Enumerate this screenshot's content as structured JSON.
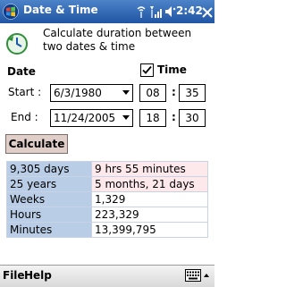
{
  "titlebar": {
    "title": "Date & Time",
    "clock": "2:42",
    "ok_label": ""
  },
  "header": {
    "description": "Calculate duration between two dates & time"
  },
  "date_section": {
    "label": "Date"
  },
  "time_section": {
    "label": "Time",
    "checked": true
  },
  "start": {
    "label": "Start :",
    "date": "6/3/1980",
    "hour": "08",
    "minute": "35"
  },
  "end": {
    "label": "End :",
    "date": "11/24/2005",
    "hour": "18",
    "minute": "30"
  },
  "separator": ":",
  "calculate_label": "Calculate",
  "results": [
    {
      "left": "9,305 days",
      "right": "9 hrs 55 minutes"
    },
    {
      "left": "25 years",
      "right": "5 months, 21 days"
    },
    {
      "left": "Weeks",
      "right": "1,329"
    },
    {
      "left": "Hours",
      "right": "223,329"
    },
    {
      "left": "Minutes",
      "right": "13,399,795"
    }
  ],
  "menubar": {
    "file": "File",
    "help": "Help"
  },
  "colors": {
    "titlebar": "#1f55a3",
    "label_cell": "#b9cde6",
    "highlight_cell": "#fde8ec",
    "button": "#e0cfc9"
  }
}
